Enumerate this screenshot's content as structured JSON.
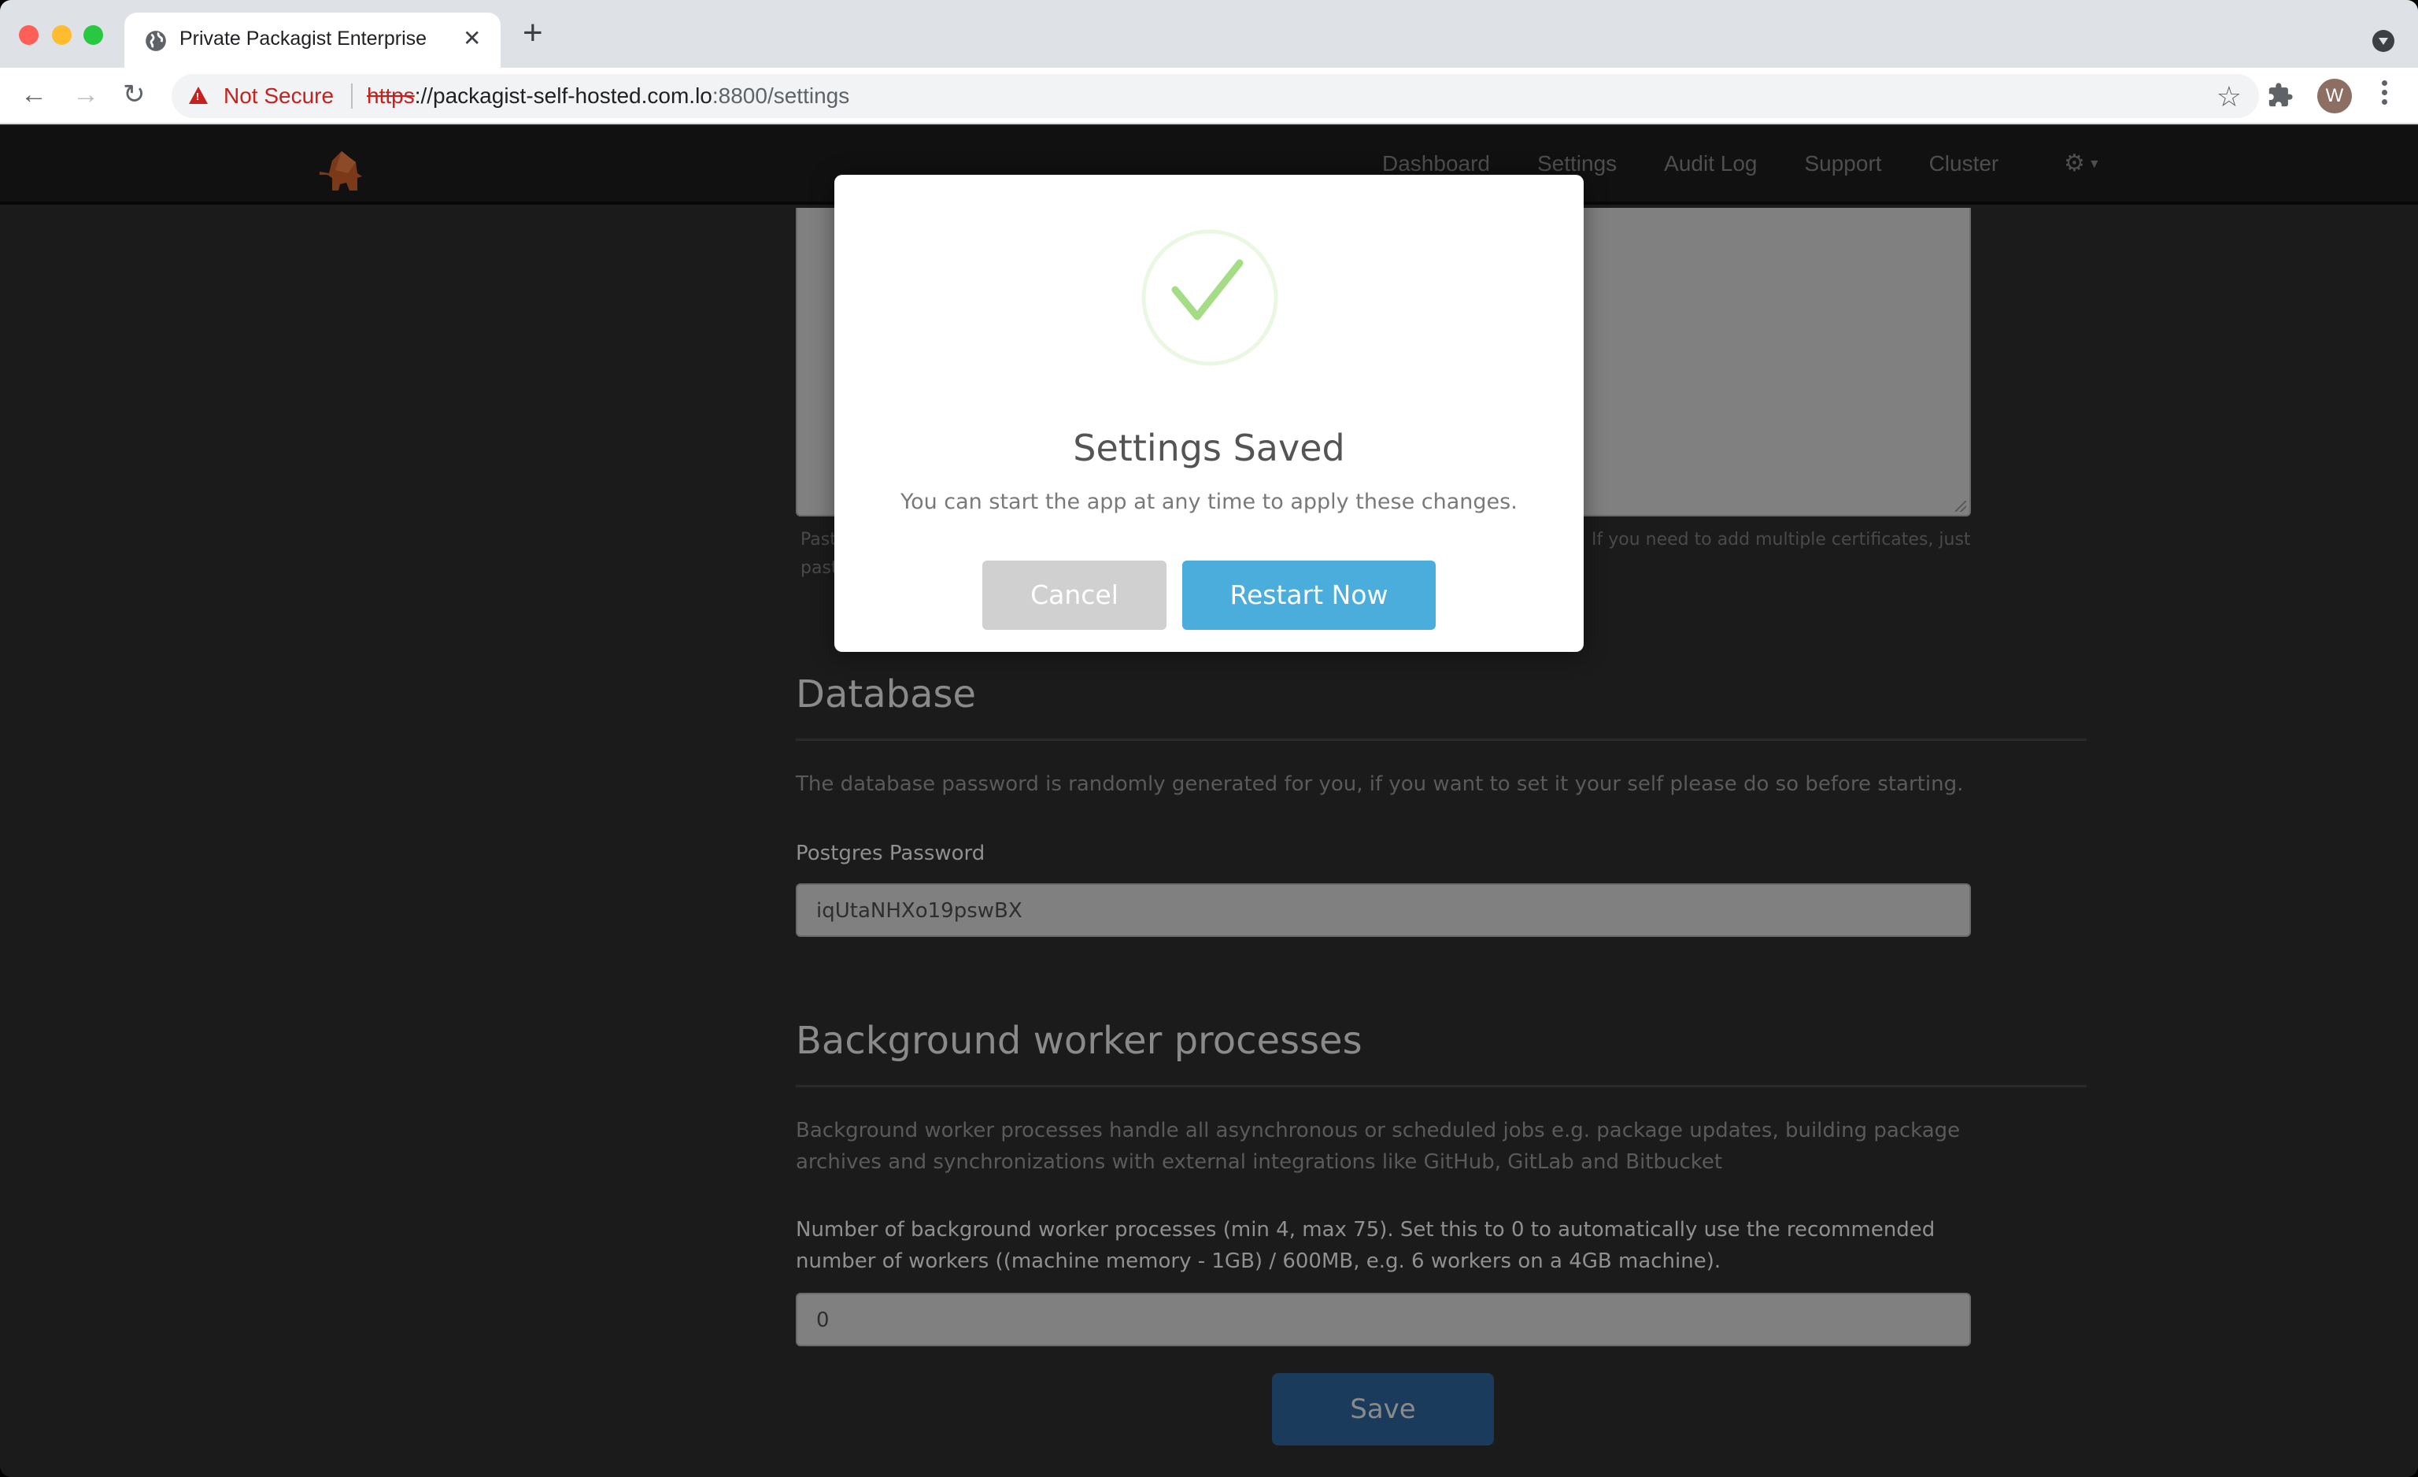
{
  "browser": {
    "tab_title": "Private Packagist Enterprise",
    "tab_close": "✕",
    "new_tab": "+",
    "security_label": "Not Secure",
    "url_scheme": "https",
    "url_host": "://packagist-self-hosted.com.lo",
    "url_rest": ":8800/settings",
    "profile_initial": "W",
    "icons": {
      "back": "←",
      "forward": "→",
      "reload": "↻",
      "star": "☆",
      "extensions": "✱"
    }
  },
  "nav": {
    "links": [
      "Dashboard",
      "Settings",
      "Audit Log",
      "Support",
      "Cluster"
    ],
    "gear": "⚙",
    "caret": "▼"
  },
  "certificates": {
    "help_left": "Paste",
    "help_left_2": "paste",
    "help_right": "If you need to add multiple certificates, just"
  },
  "database": {
    "title": "Database",
    "description": "The database password is randomly generated for you, if you want to set it your self please do so before starting.",
    "password_label": "Postgres Password",
    "password_value": "iqUtaNHXo19pswBX"
  },
  "workers": {
    "title": "Background worker processes",
    "description": "Background worker processes handle all asynchronous or scheduled jobs e.g. package updates, building package archives and synchronizations with external integrations like GitHub, GitLab and Bitbucket",
    "count_label": "Number of background worker processes (min 4, max 75). Set this to 0 to automatically use the recommended number of workers ((machine memory - 1GB) / 600MB, e.g. 6 workers on a 4GB machine).",
    "count_value": "0"
  },
  "save_label": "Save",
  "modal": {
    "title": "Settings Saved",
    "text": "You can start the app at any time to apply these changes.",
    "cancel_label": "Cancel",
    "restart_label": "Restart Now"
  },
  "colors": {
    "restart_button": "#4aaddc",
    "cancel_button": "#d0d0d0",
    "success_check": "#a5dc86",
    "save_button": "#1b3b5c",
    "not_secure": "#c5221f"
  }
}
